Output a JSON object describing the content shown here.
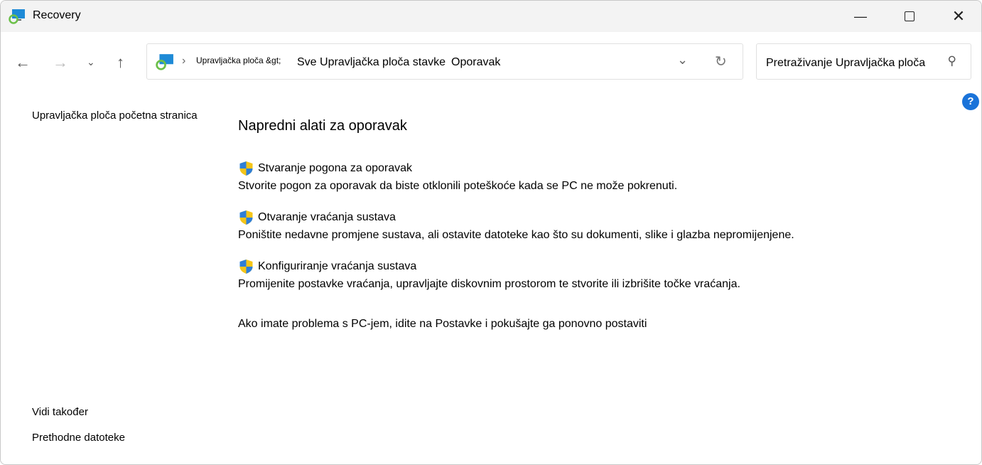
{
  "window": {
    "title": "Recovery"
  },
  "address": {
    "crumbs": [
      "Upravljačka ploča &gt;",
      "Sve Upravljačka ploča stavke",
      "Oporavak"
    ]
  },
  "search": {
    "placeholder": "Pretraživanje Upravljačka ploča"
  },
  "sidebar": {
    "home": "Upravljačka ploča početna stranica",
    "see_also": "Vidi također",
    "previous_files": "Prethodne datoteke"
  },
  "main": {
    "heading": "Napredni alati za oporavak",
    "tasks": [
      {
        "title": "Stvaranje pogona za oporavak",
        "desc": "Stvorite pogon za oporavak da biste otklonili poteškoće kada se PC ne može pokrenuti."
      },
      {
        "title": "Otvaranje vraćanja sustava",
        "desc": "Poništite nedavne promjene sustava, ali ostavite datoteke kao što su dokumenti, slike i glazba nepromijenjene."
      },
      {
        "title": "Konfiguriranje vraćanja sustava",
        "desc": "Promijenite postavke vraćanja, upravljajte diskovnim prostorom te stvorite ili izbrišite točke vraćanja."
      }
    ],
    "reset_link": "Ako imate problema s PC-jem, idite na Postavke i pokušajte ga ponovno postaviti"
  },
  "help": {
    "label": "?"
  },
  "colors": {
    "help": "#1a73d9",
    "titlebar": "#f3f3f3"
  }
}
